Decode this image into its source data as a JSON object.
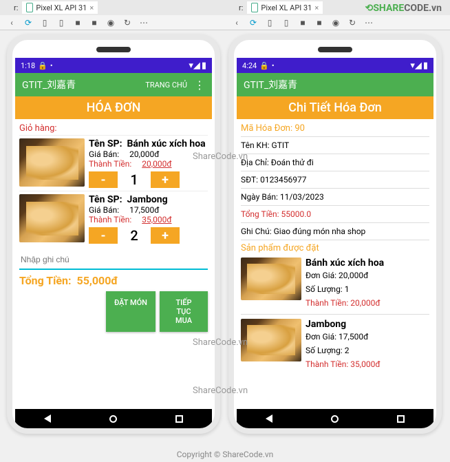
{
  "ide": {
    "tab_label": "Pixel XL API 31",
    "toolbar_icons": [
      "chevron-left",
      "phone-rotate",
      "phone-size",
      "square",
      "square",
      "camera",
      "rotate",
      "more-horiz"
    ]
  },
  "watermark": {
    "logo_left": "SHARE",
    "logo_mid": "CODE",
    "logo_right": ".vn",
    "text": "ShareCode.vn",
    "copyright": "Copyright © ShareCode.vn"
  },
  "left": {
    "time": "1:18",
    "app_title": "GTIT_刘嘉青",
    "appbar_action": "TRANG CHỦ",
    "banner": "HÓA ĐƠN",
    "cart_label": "Giỏ hàng:",
    "name_label": "Tên SP:",
    "price_label": "Giá Bán:",
    "subtotal_label": "Thành Tiền:",
    "items": [
      {
        "name": "Bánh xúc xích hoa",
        "price": "20,000đ",
        "subtotal": "20,000đ",
        "qty": "1"
      },
      {
        "name": "Jambong",
        "price": "17,500đ",
        "subtotal": "35,000đ",
        "qty": "2"
      }
    ],
    "note_placeholder": "Nhập ghi chú",
    "total_label": "Tổng Tiền:",
    "total_value": "55,000đ",
    "btn_order": "ĐẶT MÓN",
    "btn_continue": "TIẾP TỤC MUA"
  },
  "right": {
    "time": "4:24",
    "app_title": "GTIT_刘嘉青",
    "banner": "Chi Tiết Hóa Đơn",
    "order_id_label": "Mã Hóa Đơn: 90",
    "lbl_customer": "Tên KH:",
    "customer": "GTIT",
    "lbl_address": "Địa Chỉ:",
    "address": "Đoán thử đi",
    "lbl_phone": "SĐT:",
    "phone": "0123456977",
    "lbl_date": "Ngày Bán:",
    "date": "11/03/2023",
    "lbl_total": "Tổng Tiền:",
    "total": "55000.0",
    "lbl_note": "Ghi Chú:",
    "note": "Giao đúng món nha shop",
    "products_label": "Sản phẩm được đặt",
    "p_price_label": "Đơn Giá:",
    "p_qty_label": "Số Lượng:",
    "p_subtotal_label": "Thành Tiền:",
    "products": [
      {
        "name": "Bánh xúc xích hoa",
        "price": "20,000đ",
        "qty": "1",
        "subtotal": "20,000đ"
      },
      {
        "name": "Jambong",
        "price": "17,500đ",
        "qty": "2",
        "subtotal": "35,000đ"
      }
    ]
  }
}
